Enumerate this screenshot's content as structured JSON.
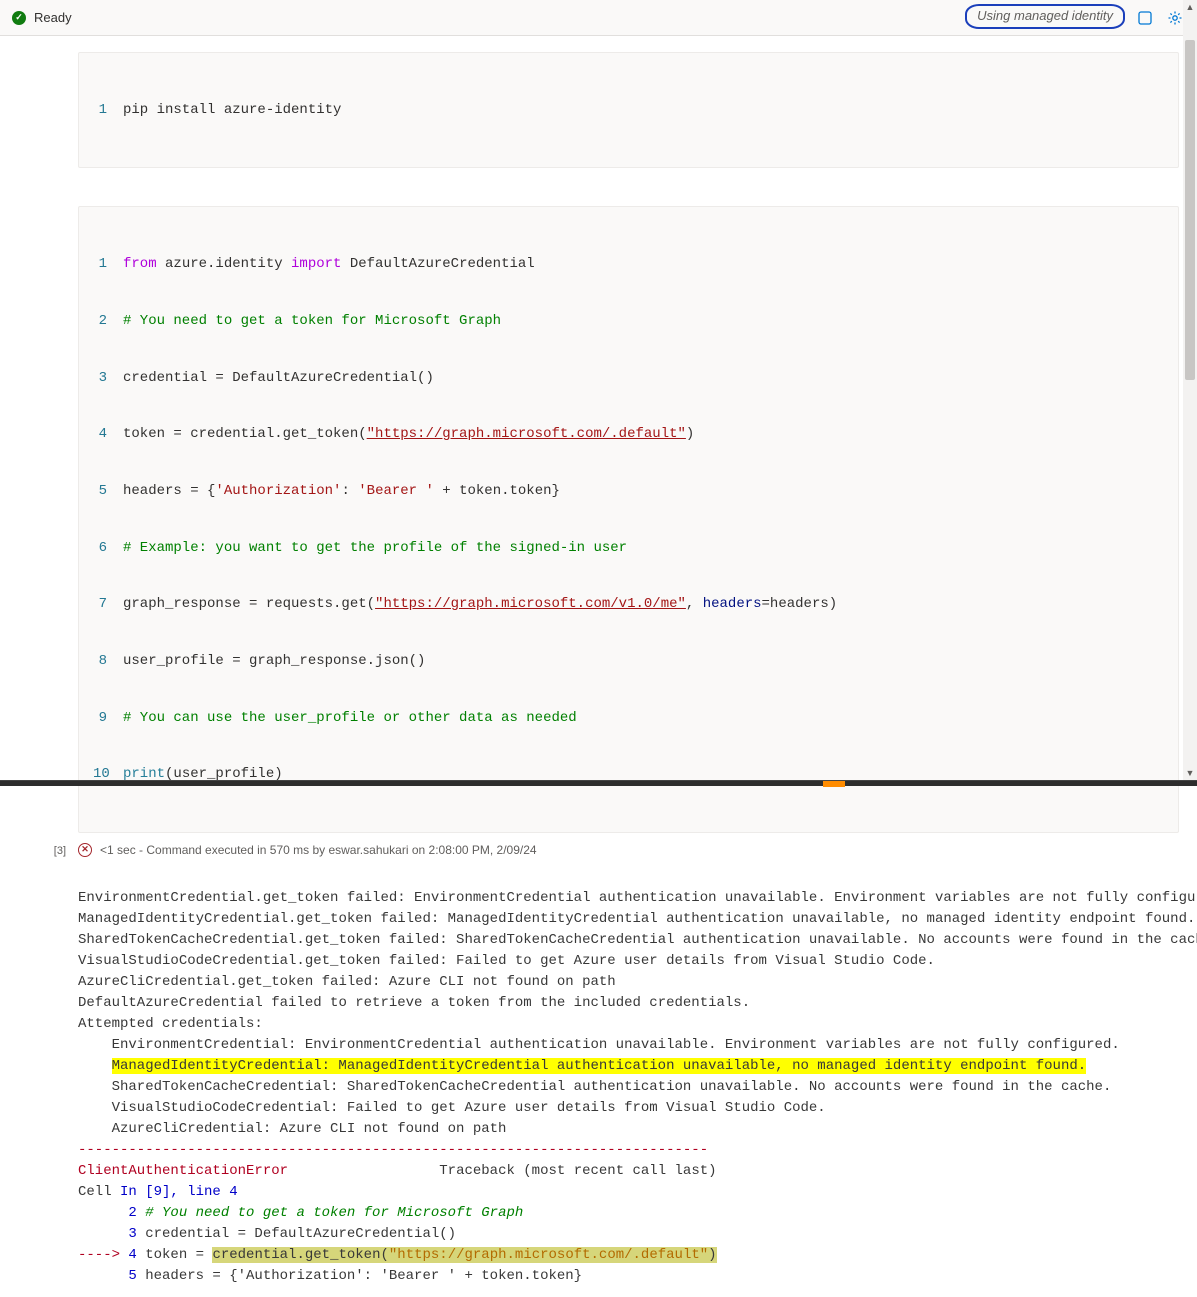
{
  "toolbar": {
    "status": "Ready",
    "identity": "Using managed identity"
  },
  "cells": {
    "c1": {
      "lines": {
        "l1": "pip install azure-identity"
      }
    },
    "c2": {
      "exec_label": "[3]",
      "lines": {
        "l1_kw1": "from",
        "l1_mod": " azure.identity ",
        "l1_kw2": "import",
        "l1_name": " DefaultAzureCredential",
        "l2": "# You need to get a token for Microsoft Graph",
        "l3_a": "credential = DefaultAzureCredential()",
        "l4_a": "token = credential.get_token(",
        "l4_s": "\"https://graph.microsoft.com/.default\"",
        "l4_b": ")",
        "l5_a": "headers = {",
        "l5_s1": "'Authorization'",
        "l5_b": ": ",
        "l5_s2": "'Bearer '",
        "l5_c": " + token.token}",
        "l6": "# Example: you want to get the profile of the signed-in user",
        "l7_a": "graph_response = requests.get(",
        "l7_s": "\"https://graph.microsoft.com/v1.0/me\"",
        "l7_b": ", ",
        "l7_p": "headers",
        "l7_c": "=headers)",
        "l8": "user_profile = graph_response.json()",
        "l9": "# You can use the user_profile or other data as needed",
        "l10_a": "print",
        "l10_b": "(user_profile)"
      },
      "status": {
        "time_prefix": "<1 sec",
        "text": " - Command executed in 570 ms by eswar.sahukari on 2:08:00 PM, 2/09/24"
      }
    }
  },
  "output": {
    "o1": "EnvironmentCredential.get_token failed: EnvironmentCredential authentication unavailable. Environment variables are not fully configured.",
    "o2": "ManagedIdentityCredential.get_token failed: ManagedIdentityCredential authentication unavailable, no managed identity endpoint found.",
    "o3": "SharedTokenCacheCredential.get_token failed: SharedTokenCacheCredential authentication unavailable. No accounts were found in the cache.",
    "o4": "VisualStudioCodeCredential.get_token failed: Failed to get Azure user details from Visual Studio Code.",
    "o5": "AzureCliCredential.get_token failed: Azure CLI not found on path",
    "o6": "DefaultAzureCredential failed to retrieve a token from the included credentials.",
    "o7": "Attempted credentials:",
    "o8": "EnvironmentCredential: EnvironmentCredential authentication unavailable. Environment variables are not fully configured.",
    "o9": "ManagedIdentityCredential: ManagedIdentityCredential authentication unavailable, no managed identity endpoint found.",
    "o10": "SharedTokenCacheCredential: SharedTokenCacheCredential authentication unavailable. No accounts were found in the cache.",
    "o11": "VisualStudioCodeCredential: Failed to get Azure user details from Visual Studio Code.",
    "o12": "AzureCliCredential: Azure CLI not found on path",
    "sep": "---------------------------------------------------------------------------",
    "err_name": "ClientAuthenticationError",
    "err_tb": "                  Traceback (most recent call last)",
    "cell_ref_a": "Cell ",
    "cell_ref_b": "In [9], line 4",
    "tb_l2_n": "      2",
    "tb_l2": " # You need to get a token for Microsoft Graph",
    "tb_l3_n": "      3",
    "tb_l3": " credential = DefaultAzureCredential()",
    "tb_arrow": "----> ",
    "tb_l4_n": "4",
    "tb_l4_a": " token = ",
    "tb_l4_h1": "credential.get_token(",
    "tb_l4_h2": "\"https://graph.microsoft.com/.default\"",
    "tb_l4_h3": ")",
    "tb_l5_n": "      5",
    "tb_l5": " headers = {'Authorization': 'Bearer ' + token.token}"
  }
}
